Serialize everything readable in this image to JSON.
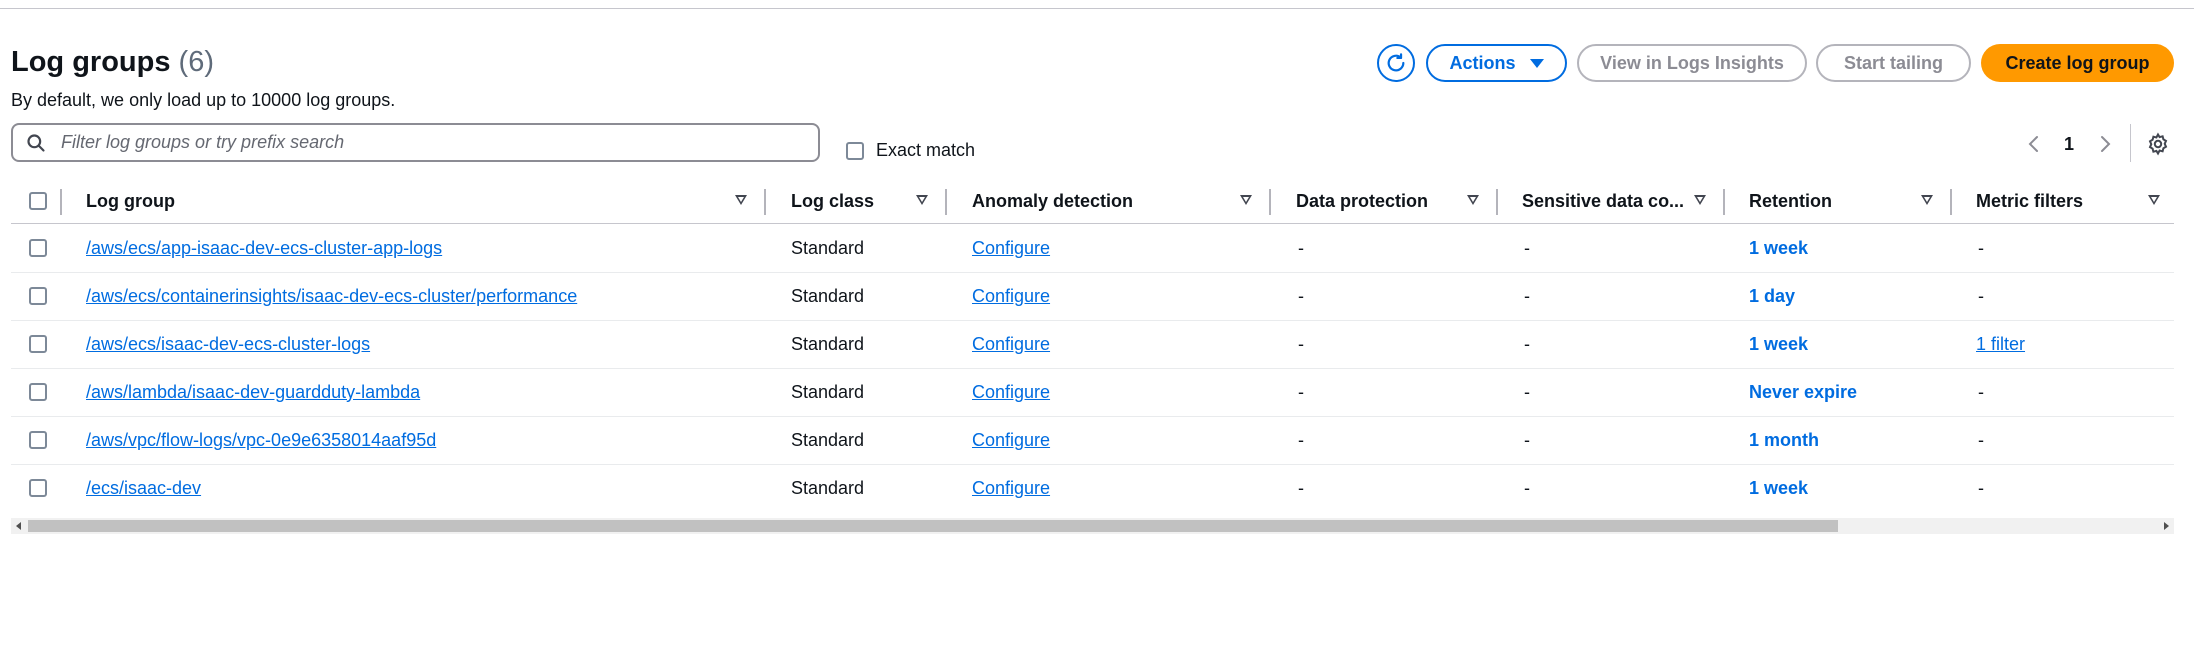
{
  "header": {
    "title": "Log groups",
    "count": "(6)",
    "subtitle": "By default, we only load up to 10000 log groups."
  },
  "toolbar": {
    "actions_label": "Actions",
    "view_insights_label": "View in Logs Insights",
    "start_tailing_label": "Start tailing",
    "create_label": "Create log group"
  },
  "search": {
    "placeholder": "Filter log groups or try prefix search",
    "value": ""
  },
  "exact_match": {
    "label": "Exact match",
    "checked": false
  },
  "pagination": {
    "current_page": "1"
  },
  "table": {
    "columns": [
      "Log group",
      "Log class",
      "Anomaly detection",
      "Data protection",
      "Sensitive data co...",
      "Retention",
      "Metric filters"
    ],
    "rows": [
      {
        "name": "/aws/ecs/app-isaac-dev-ecs-cluster-app-logs",
        "log_class": "Standard",
        "anomaly": "Configure",
        "data_protection": "-",
        "sensitive": "-",
        "retention": "1 week",
        "metric_filters": "-"
      },
      {
        "name": "/aws/ecs/containerinsights/isaac-dev-ecs-cluster/performance",
        "log_class": "Standard",
        "anomaly": "Configure",
        "data_protection": "-",
        "sensitive": "-",
        "retention": "1 day",
        "metric_filters": "-"
      },
      {
        "name": "/aws/ecs/isaac-dev-ecs-cluster-logs",
        "log_class": "Standard",
        "anomaly": "Configure",
        "data_protection": "-",
        "sensitive": "-",
        "retention": "1 week",
        "metric_filters": "1 filter"
      },
      {
        "name": "/aws/lambda/isaac-dev-guardduty-lambda",
        "log_class": "Standard",
        "anomaly": "Configure",
        "data_protection": "-",
        "sensitive": "-",
        "retention": "Never expire",
        "metric_filters": "-"
      },
      {
        "name": "/aws/vpc/flow-logs/vpc-0e9e6358014aaf95d",
        "log_class": "Standard",
        "anomaly": "Configure",
        "data_protection": "-",
        "sensitive": "-",
        "retention": "1 month",
        "metric_filters": "-"
      },
      {
        "name": "/ecs/isaac-dev",
        "log_class": "Standard",
        "anomaly": "Configure",
        "data_protection": "-",
        "sensitive": "-",
        "retention": "1 week",
        "metric_filters": "-"
      }
    ]
  },
  "colors": {
    "link": "#006ce0",
    "primary_button": "#ff9900",
    "border": "#c6c6cd"
  }
}
